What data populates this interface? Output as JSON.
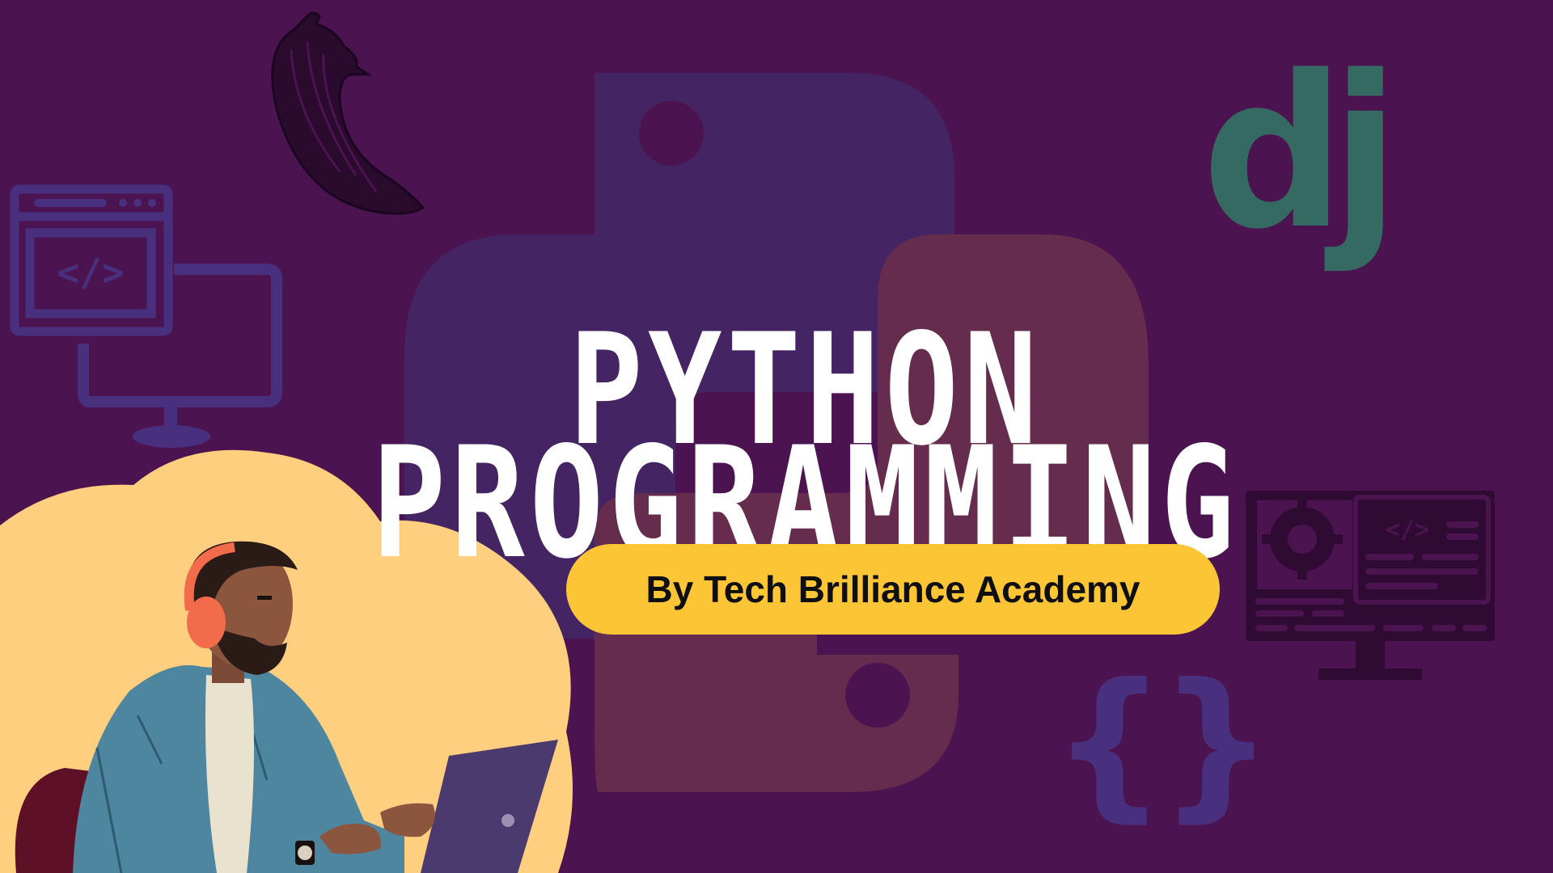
{
  "title": {
    "line1": "PYTHON",
    "line2": "PROGRAMMING"
  },
  "subtitle": "By Tech Brilliance Academy",
  "logos": {
    "django": "dj"
  },
  "colors": {
    "background": "#4b1350",
    "python_upper": "#452463",
    "python_lower": "#652c4d",
    "cloud": "#fdcf7e",
    "pill": "#fcc536",
    "icons": "#49307e",
    "django": "#346a62",
    "title": "#ffffff"
  },
  "icons": [
    "python-logo",
    "flask-horn-icon",
    "code-window-icon",
    "monitor-icon",
    "django-logo",
    "code-settings-screen-icon",
    "curly-braces-icon",
    "developer-illustration"
  ]
}
